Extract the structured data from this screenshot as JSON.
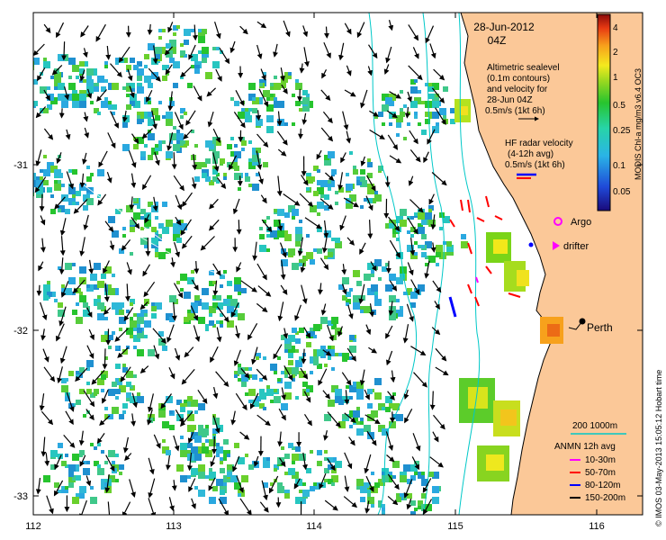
{
  "header": {
    "date": "28-Jun-2012",
    "time": "04Z"
  },
  "altimetry_note": {
    "line1": "Altimetric sealevel",
    "line2": "(0.1m contours)",
    "line3": "and velocity for",
    "line4": "28-Jun 04Z",
    "line5": "0.5m/s (1kt 6h)"
  },
  "hf_radar_note": {
    "line1": "HF radar velocity",
    "line2": "(4-12h avg)",
    "line3": "0.5m/s (1kt 6h)"
  },
  "colorbar": {
    "title": "MODIS Chl-a mg/m3 v6.4 OC3",
    "ticks": [
      "4",
      "2",
      "1",
      "0.5",
      "0.25",
      "0.1",
      "0.05"
    ]
  },
  "markers": {
    "argo": "Argo",
    "drifter": "drifter",
    "city": "Perth"
  },
  "depth_legend": {
    "label": "200  1000m",
    "color": "#00c8c8"
  },
  "anmn_legend": {
    "title": "ANMN 12h avg",
    "items": [
      {
        "label": "10-30m",
        "color": "#ff00ff"
      },
      {
        "label": "50-70m",
        "color": "#ff0000"
      },
      {
        "label": "80-120m",
        "color": "#0000ff"
      },
      {
        "label": "150-200m",
        "color": "#000000"
      }
    ]
  },
  "axes": {
    "x_ticks": [
      "112",
      "113",
      "114",
      "115",
      "116"
    ],
    "y_ticks": [
      "-31",
      "-32",
      "-33"
    ]
  },
  "credit": "© IMOS 03-May-2013 15:05:12 Hobart time",
  "colors": {
    "land": "#fbc898",
    "coast": "#000000",
    "contour": "#00c8c8"
  }
}
